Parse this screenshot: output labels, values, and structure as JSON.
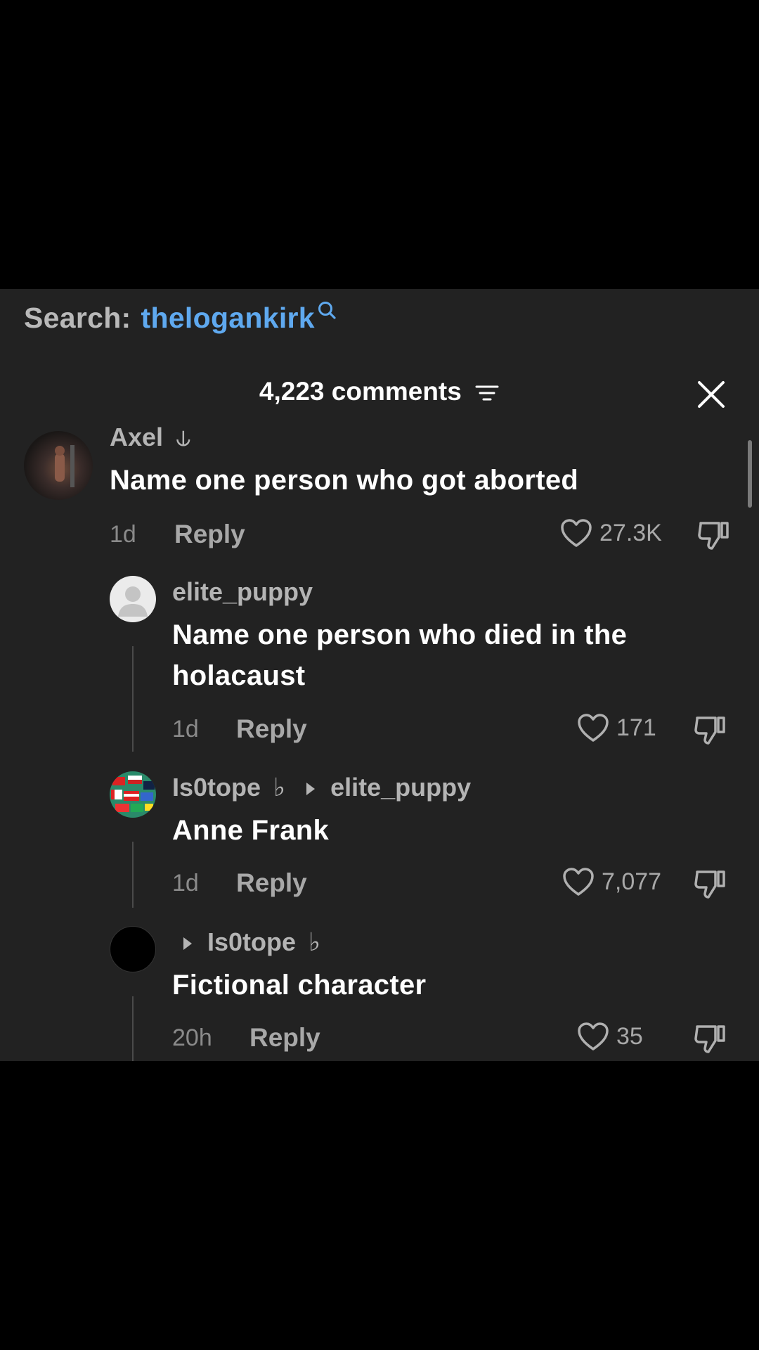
{
  "search": {
    "label": "Search:",
    "term": "thelogankirk"
  },
  "header": {
    "comment_count": "4,223 comments"
  },
  "comments": [
    {
      "username": "Axel",
      "name_symbol": "⫝",
      "text": "Name one person who got aborted",
      "time": "1d",
      "reply_label": "Reply",
      "likes": "27.3K"
    },
    {
      "username": "elite_puppy",
      "text": "Name one person who died in the holacaust",
      "time": "1d",
      "reply_label": "Reply",
      "likes": "171"
    },
    {
      "username": "Is0tope",
      "name_symbol": "♭",
      "reply_to": "elite_puppy",
      "text": "Anne Frank",
      "time": "1d",
      "reply_label": "Reply",
      "likes": "7,077"
    },
    {
      "username": "",
      "reply_to": "Is0tope",
      "reply_to_symbol": "♭",
      "text": "Fictional character",
      "time": "20h",
      "reply_label": "Reply",
      "likes": "35"
    }
  ],
  "colors": {
    "panel_bg": "#222222",
    "accent_search": "#5fa9ef",
    "muted": "#a8a8a8"
  }
}
